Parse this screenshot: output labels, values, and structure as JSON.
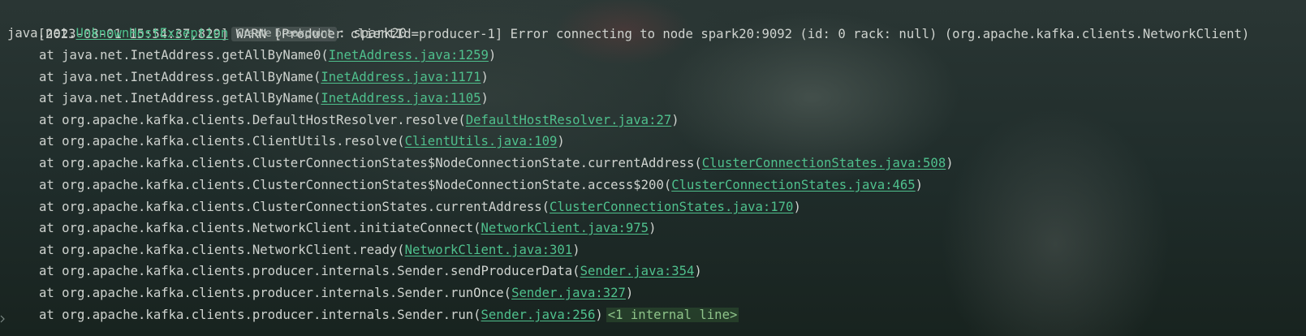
{
  "log_header": "[2023-08-01 15:54:37,829] WARN [Producer clientId=producer-1] Error connecting to node spark20:9092 (id: 0 rack: null) (org.apache.kafka.clients.NetworkClient)",
  "exception": {
    "prefix": "java.net.",
    "class_name": "UnknownHostException",
    "breakpoint_label": "Create breakpoint",
    "suffix": ": spark20"
  },
  "frames": [
    {
      "method": "at java.net.InetAddress.getAllByName0(",
      "link": "InetAddress.java:1259",
      "close": ")"
    },
    {
      "method": "at java.net.InetAddress.getAllByName(",
      "link": "InetAddress.java:1171",
      "close": ")"
    },
    {
      "method": "at java.net.InetAddress.getAllByName(",
      "link": "InetAddress.java:1105",
      "close": ")"
    },
    {
      "method": "at org.apache.kafka.clients.DefaultHostResolver.resolve(",
      "link": "DefaultHostResolver.java:27",
      "close": ")"
    },
    {
      "method": "at org.apache.kafka.clients.ClientUtils.resolve(",
      "link": "ClientUtils.java:109",
      "close": ")"
    },
    {
      "method": "at org.apache.kafka.clients.ClusterConnectionStates$NodeConnectionState.currentAddress(",
      "link": "ClusterConnectionStates.java:508",
      "close": ")"
    },
    {
      "method": "at org.apache.kafka.clients.ClusterConnectionStates$NodeConnectionState.access$200(",
      "link": "ClusterConnectionStates.java:465",
      "close": ")"
    },
    {
      "method": "at org.apache.kafka.clients.ClusterConnectionStates.currentAddress(",
      "link": "ClusterConnectionStates.java:170",
      "close": ")"
    },
    {
      "method": "at org.apache.kafka.clients.NetworkClient.initiateConnect(",
      "link": "NetworkClient.java:975",
      "close": ")"
    },
    {
      "method": "at org.apache.kafka.clients.NetworkClient.ready(",
      "link": "NetworkClient.java:301",
      "close": ")"
    },
    {
      "method": "at org.apache.kafka.clients.producer.internals.Sender.sendProducerData(",
      "link": "Sender.java:354",
      "close": ")"
    },
    {
      "method": "at org.apache.kafka.clients.producer.internals.Sender.runOnce(",
      "link": "Sender.java:327",
      "close": ")"
    },
    {
      "method": "at org.apache.kafka.clients.producer.internals.Sender.run(",
      "link": "Sender.java:256",
      "close": ")"
    }
  ],
  "internal_lines_label": "<1 internal line>",
  "icons": {
    "fold": "chevron-right-icon"
  },
  "colors": {
    "link": "#4fc08d",
    "text": "#cfd3cf",
    "background": "#1f2b29"
  }
}
